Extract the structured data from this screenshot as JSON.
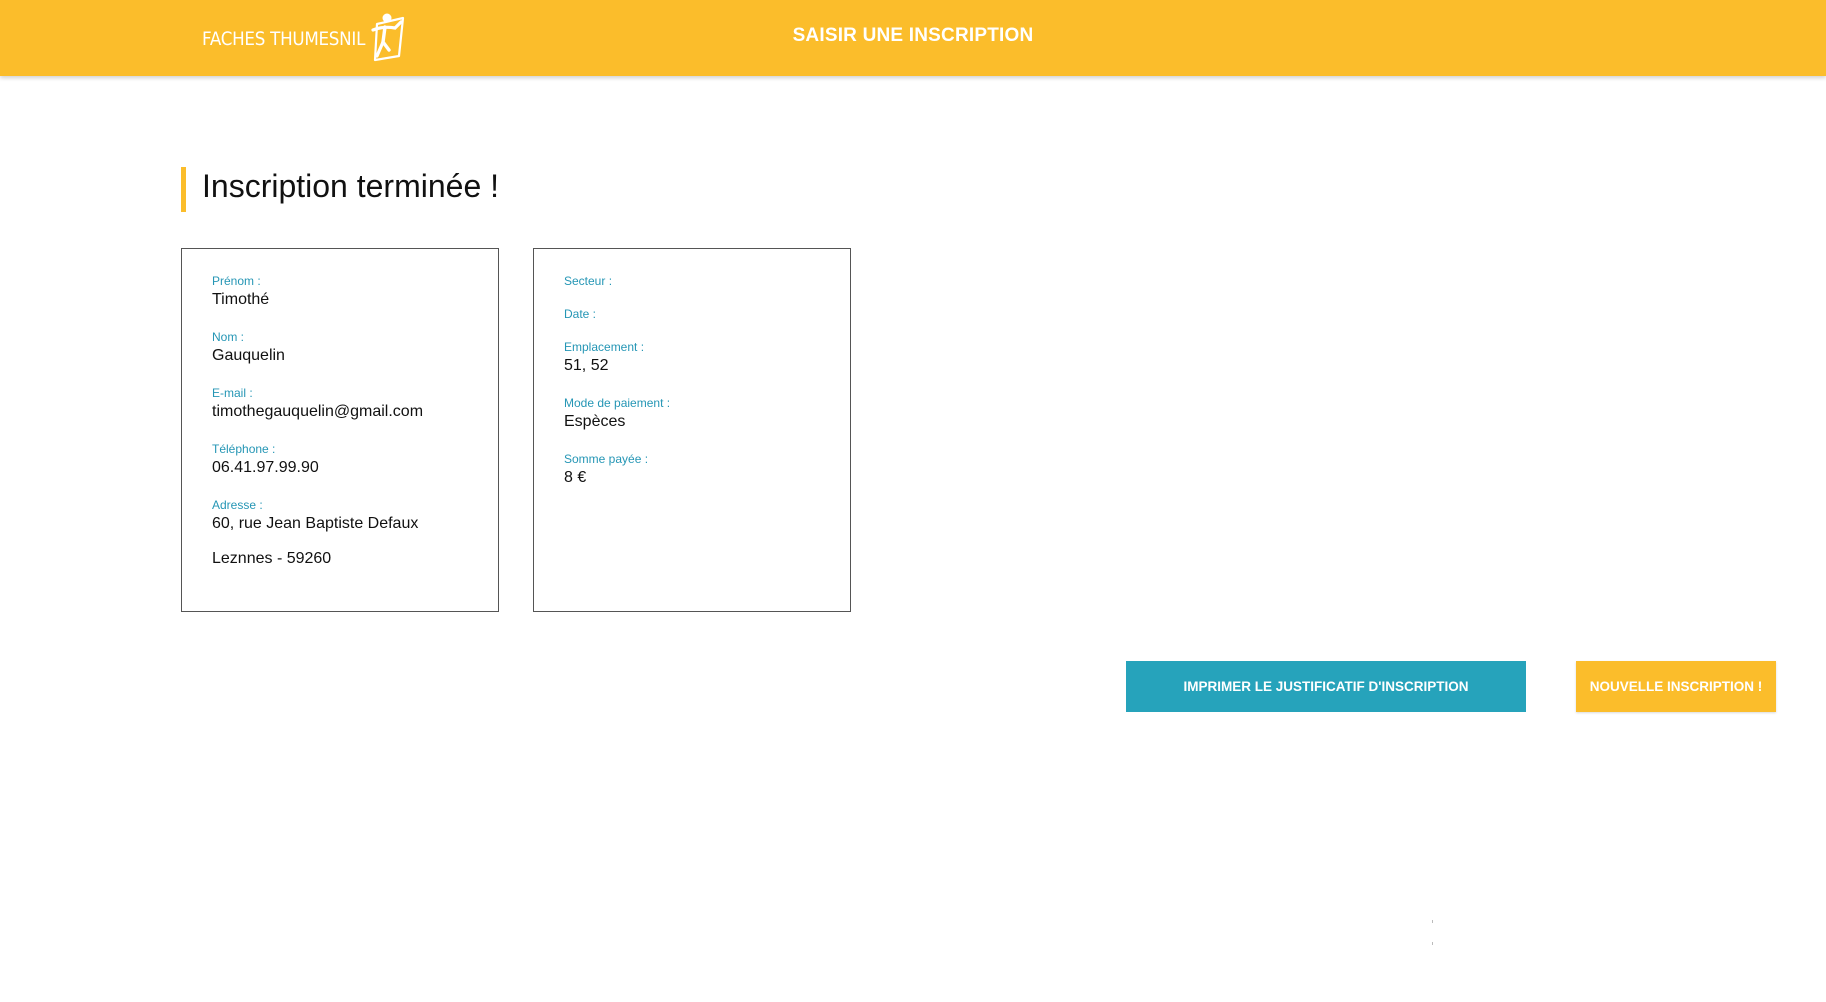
{
  "header": {
    "logo_text": "FACHES THUMESNIL",
    "title": "SAISIR UNE INSCRIPTION",
    "bg_color": "#fbbd2b"
  },
  "page": {
    "title": "Inscription terminée !"
  },
  "person": {
    "prenom_label": "Prénom :",
    "prenom": "Timothé",
    "nom_label": "Nom :",
    "nom": "Gauquelin",
    "email_label": "E-mail :",
    "email": "timothegauquelin@gmail.com",
    "telephone_label": "Téléphone :",
    "telephone": "06.41.97.99.90",
    "adresse_label": "Adresse :",
    "adresse_line1": "60, rue Jean Baptiste Defaux",
    "adresse_line2": "Leznnes - 59260"
  },
  "booking": {
    "secteur_label": "Secteur :",
    "secteur": "",
    "date_label": "Date :",
    "date": "",
    "emplacement_label": "Emplacement :",
    "emplacement": "51, 52",
    "paiement_label": "Mode de paiement :",
    "paiement": "Espèces",
    "somme_label": "Somme payée :",
    "somme": "8 €"
  },
  "actions": {
    "print_label": "IMPRIMER LE JUSTIFICATIF D'INSCRIPTION",
    "print_color": "#26a3bb",
    "new_label": "NOUVELLE INSCRIPTION !",
    "new_color": "#fbbd2b"
  },
  "colors": {
    "accent": "#fbbd2b",
    "label": "#2596b5"
  }
}
